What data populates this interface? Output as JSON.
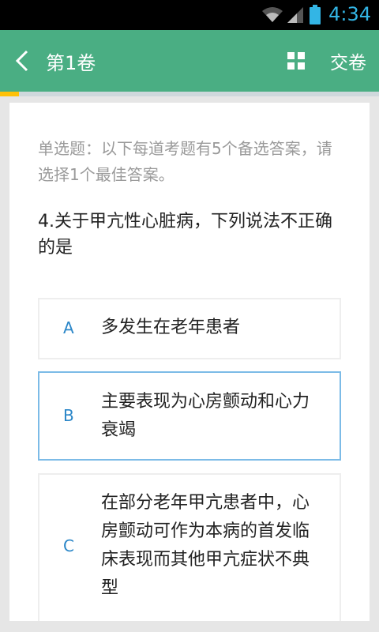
{
  "status_bar": {
    "time": "4:34",
    "icons": [
      "wifi-icon",
      "signal-icon",
      "battery-icon"
    ],
    "accent_color": "#33b5e5"
  },
  "app_bar": {
    "back_icon": "back-arrow-icon",
    "title": "第1卷",
    "grid_icon": "grid-icon",
    "submit_label": "交卷",
    "background_color": "#4aae83"
  },
  "progress": {
    "fraction": 0.05,
    "color": "#ffc107"
  },
  "question_card": {
    "instruction": "单选题：以下每道考题有5个备选答案，请选择1个最佳答案。",
    "question": "4.关于甲亢性心脏病，下列说法不正确的是",
    "options": [
      {
        "letter": "A",
        "text": "多发生在老年患者",
        "selected": false
      },
      {
        "letter": "B",
        "text": "主要表现为心房颤动和心力衰竭",
        "selected": true
      },
      {
        "letter": "C",
        "text": "在部分老年甲亢患者中，心房颤动可作为本病的首发临床表现而其他甲亢症状不典型",
        "selected": false
      }
    ]
  }
}
